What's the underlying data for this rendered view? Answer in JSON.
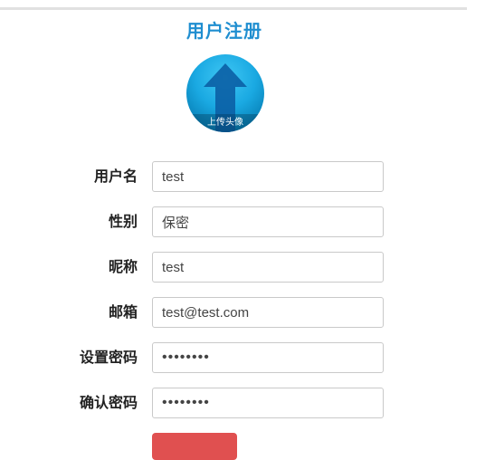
{
  "page": {
    "title": "用户注册"
  },
  "avatar": {
    "caption": "上传头像",
    "icon": "upload-arrow-icon",
    "colors": {
      "background": "#1aa9e2",
      "arrow": "#0b5fa5"
    }
  },
  "form": {
    "username": {
      "label": "用户名",
      "value": "test"
    },
    "gender": {
      "label": "性别",
      "value": "保密"
    },
    "nickname": {
      "label": "昵称",
      "value": "test"
    },
    "email": {
      "label": "邮箱",
      "value": "test@test.com"
    },
    "password": {
      "label": "设置密码",
      "value": "password"
    },
    "confirm_password": {
      "label": "确认密码",
      "value": "password"
    }
  },
  "submit": {
    "label": "",
    "color": "#e05050"
  },
  "colors": {
    "title": "#1f8ed0",
    "label": "#222222",
    "input_border": "#c9c9c9"
  }
}
